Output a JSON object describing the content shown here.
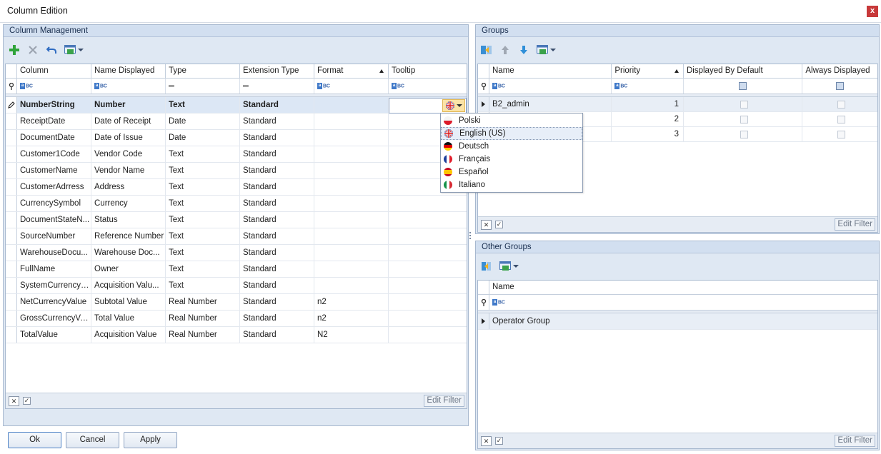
{
  "window": {
    "title": "Column Edition",
    "close_glyph": "x"
  },
  "column_management": {
    "title": "Column Management",
    "toolbar": [
      "add-icon",
      "delete-icon",
      "undo-icon",
      "layout-icon"
    ],
    "headers": [
      "Column",
      "Name Displayed",
      "Type",
      "Extension Type",
      "Format",
      "Tooltip"
    ],
    "sorted_column": "Format",
    "rows": [
      {
        "column": "NumberString",
        "name": "Number",
        "type": "Text",
        "ext": "Standard",
        "format": "",
        "tooltip": ""
      },
      {
        "column": "ReceiptDate",
        "name": "Date of Receipt",
        "type": "Date",
        "ext": "Standard",
        "format": "",
        "tooltip": ""
      },
      {
        "column": "DocumentDate",
        "name": "Date of Issue",
        "type": "Date",
        "ext": "Standard",
        "format": "",
        "tooltip": ""
      },
      {
        "column": "Customer1Code",
        "name": "Vendor Code",
        "type": "Text",
        "ext": "Standard",
        "format": "",
        "tooltip": ""
      },
      {
        "column": "CustomerName",
        "name": "Vendor Name",
        "type": "Text",
        "ext": "Standard",
        "format": "",
        "tooltip": ""
      },
      {
        "column": "CustomerAdrress",
        "name": "Address",
        "type": "Text",
        "ext": "Standard",
        "format": "",
        "tooltip": ""
      },
      {
        "column": "CurrencySymbol",
        "name": "Currency",
        "type": "Text",
        "ext": "Standard",
        "format": "",
        "tooltip": ""
      },
      {
        "column": "DocumentStateN...",
        "name": "Status",
        "type": "Text",
        "ext": "Standard",
        "format": "",
        "tooltip": ""
      },
      {
        "column": "SourceNumber",
        "name": "Reference Number",
        "type": "Text",
        "ext": "Standard",
        "format": "",
        "tooltip": ""
      },
      {
        "column": "WarehouseDocu...",
        "name": "Warehouse Doc...",
        "type": "Text",
        "ext": "Standard",
        "format": "",
        "tooltip": ""
      },
      {
        "column": "FullName",
        "name": "Owner",
        "type": "Text",
        "ext": "Standard",
        "format": "",
        "tooltip": ""
      },
      {
        "column": "SystemCurrencyS...",
        "name": "Acquisition Valu...",
        "type": "Text",
        "ext": "Standard",
        "format": "",
        "tooltip": ""
      },
      {
        "column": "NetCurrencyValue",
        "name": "Subtotal Value",
        "type": "Real Number",
        "ext": "Standard",
        "format": "n2",
        "tooltip": ""
      },
      {
        "column": "GrossCurrencyVa...",
        "name": "Total Value",
        "type": "Real Number",
        "ext": "Standard",
        "format": "n2",
        "tooltip": ""
      },
      {
        "column": "TotalValue",
        "name": "Acquisition Value",
        "type": "Real Number",
        "ext": "Standard",
        "format": "N2",
        "tooltip": ""
      }
    ],
    "edit_filter": "Edit Filter"
  },
  "language_dropdown": {
    "selected": "English (US)",
    "options": [
      {
        "label": "Polski",
        "flag": "pl"
      },
      {
        "label": "English (US)",
        "flag": "gb"
      },
      {
        "label": "Deutsch",
        "flag": "de"
      },
      {
        "label": "Français",
        "flag": "fr"
      },
      {
        "label": "Español",
        "flag": "es"
      },
      {
        "label": "Italiano",
        "flag": "it"
      }
    ]
  },
  "groups": {
    "title": "Groups",
    "headers": [
      "Name",
      "Priority",
      "Displayed By Default",
      "Always Displayed"
    ],
    "rows": [
      {
        "name": "B2_admin",
        "priority": "1"
      },
      {
        "name": "",
        "priority": "2"
      },
      {
        "name": "",
        "priority": "3"
      }
    ],
    "edit_filter": "Edit Filter"
  },
  "other_groups": {
    "title": "Other Groups",
    "headers": [
      "Name"
    ],
    "rows": [
      {
        "name": "Operator Group"
      }
    ],
    "edit_filter": "Edit Filter"
  },
  "buttons": {
    "ok": "Ok",
    "cancel": "Cancel",
    "apply": "Apply"
  },
  "colors": {
    "panel_bg": "#dfe8f3",
    "selected_row": "#dce7f5",
    "close_button": "#c8393a"
  }
}
